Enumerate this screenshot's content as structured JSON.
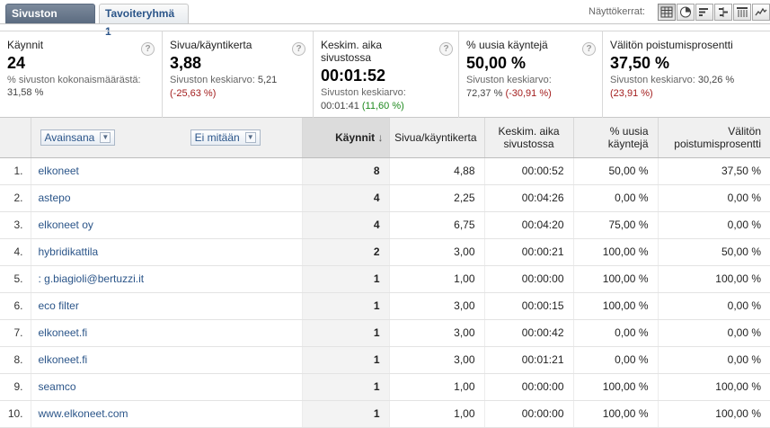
{
  "tabs": {
    "active": "Sivuston käyttö",
    "inactive": "Tavoiteryhmä 1"
  },
  "views_label": "Näyttökerrat:",
  "scorecard": [
    {
      "title": "Käynnit",
      "value": "24",
      "sub_prefix": "% sivuston kokonaismäärästä: ",
      "sub_value": "31,58 %",
      "delta": ""
    },
    {
      "title": "Sivua/käyntikerta",
      "value": "3,88",
      "sub_prefix": "Sivuston keskiarvo: ",
      "sub_value": "5,21",
      "delta": "(-25,63 %)"
    },
    {
      "title": "Keskim. aika sivustossa",
      "value": "00:01:52",
      "sub_prefix": "Sivuston keskiarvo: ",
      "sub_value": "00:01:41",
      "delta": "(11,60 %)"
    },
    {
      "title": "% uusia käyntejä",
      "value": "50,00 %",
      "sub_prefix": "Sivuston keskiarvo: ",
      "sub_value": "72,37 %",
      "delta": "(-30,91 %)"
    },
    {
      "title": "Välitön poistumisprosentti",
      "value": "37,50 %",
      "sub_prefix": "Sivuston keskiarvo: ",
      "sub_value": "30,26 %",
      "delta": "(23,91 %)"
    }
  ],
  "table": {
    "dimension_select": "Avainsana",
    "secondary_select": "Ei mitään",
    "headers": {
      "visits": "Käynnit",
      "pages_per_visit": "Sivua/käyntikerta",
      "avg_time": "Keskim. aika sivustossa",
      "new_visits": "% uusia käyntejä",
      "bounce": "Välitön poistumisprosentti"
    },
    "rows": [
      {
        "idx": "1.",
        "keyword": "elkoneet",
        "visits": "8",
        "ppv": "4,88",
        "time": "00:00:52",
        "new": "50,00 %",
        "bounce": "37,50 %"
      },
      {
        "idx": "2.",
        "keyword": "astepo",
        "visits": "4",
        "ppv": "2,25",
        "time": "00:04:26",
        "new": "0,00 %",
        "bounce": "0,00 %"
      },
      {
        "idx": "3.",
        "keyword": "elkoneet oy",
        "visits": "4",
        "ppv": "6,75",
        "time": "00:04:20",
        "new": "75,00 %",
        "bounce": "0,00 %"
      },
      {
        "idx": "4.",
        "keyword": "hybridikattila",
        "visits": "2",
        "ppv": "3,00",
        "time": "00:00:21",
        "new": "100,00 %",
        "bounce": "50,00 %"
      },
      {
        "idx": "5.",
        "keyword": ": g.biagioli@bertuzzi.it",
        "visits": "1",
        "ppv": "1,00",
        "time": "00:00:00",
        "new": "100,00 %",
        "bounce": "100,00 %"
      },
      {
        "idx": "6.",
        "keyword": "eco filter",
        "visits": "1",
        "ppv": "3,00",
        "time": "00:00:15",
        "new": "100,00 %",
        "bounce": "0,00 %"
      },
      {
        "idx": "7.",
        "keyword": "elkoneet.fi",
        "visits": "1",
        "ppv": "3,00",
        "time": "00:00:42",
        "new": "0,00 %",
        "bounce": "0,00 %"
      },
      {
        "idx": "8.",
        "keyword": "elkoneet.fi",
        "visits": "1",
        "ppv": "3,00",
        "time": "00:01:21",
        "new": "0,00 %",
        "bounce": "0,00 %"
      },
      {
        "idx": "9.",
        "keyword": "seamco",
        "visits": "1",
        "ppv": "1,00",
        "time": "00:00:00",
        "new": "100,00 %",
        "bounce": "100,00 %"
      },
      {
        "idx": "10.",
        "keyword": "www.elkoneet.com",
        "visits": "1",
        "ppv": "1,00",
        "time": "00:00:00",
        "new": "100,00 %",
        "bounce": "100,00 %"
      }
    ]
  },
  "colors": {
    "link": "#2b5589",
    "negative": "#a31e1e",
    "positive": "#1f8a1f"
  }
}
